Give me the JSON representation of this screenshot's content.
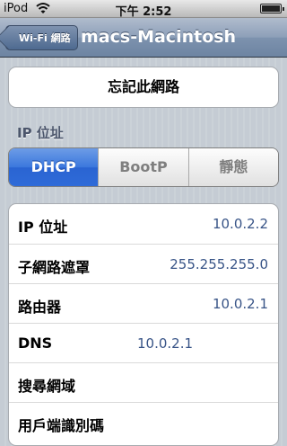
{
  "status_bar": {
    "carrier": "iPod",
    "time": "下午 2:52",
    "battery_level": 1.0,
    "wifi_icon": "wifi-icon"
  },
  "nav": {
    "back_label": "Wi-Fi 網路",
    "title": "macs-Macintosh"
  },
  "forget_button": "忘記此網路",
  "section_title": "IP 位址",
  "segments": [
    {
      "label": "DHCP",
      "active": true
    },
    {
      "label": "BootP",
      "active": false
    },
    {
      "label": "靜態",
      "active": false
    }
  ],
  "rows": [
    {
      "label": "IP 位址",
      "value": "10.0.2.2"
    },
    {
      "label": "子網路遮罩",
      "value": "255.255.255.0"
    },
    {
      "label": "路由器",
      "value": "10.0.2.1"
    },
    {
      "label": "DNS",
      "value": "10.0.2.1"
    },
    {
      "label": "搜尋網域",
      "value": ""
    },
    {
      "label": "用戶端識別碼",
      "value": ""
    }
  ],
  "colors": {
    "accent": "#2f6bd8",
    "value_text": "#385487",
    "navbar": "#6d84a2"
  }
}
